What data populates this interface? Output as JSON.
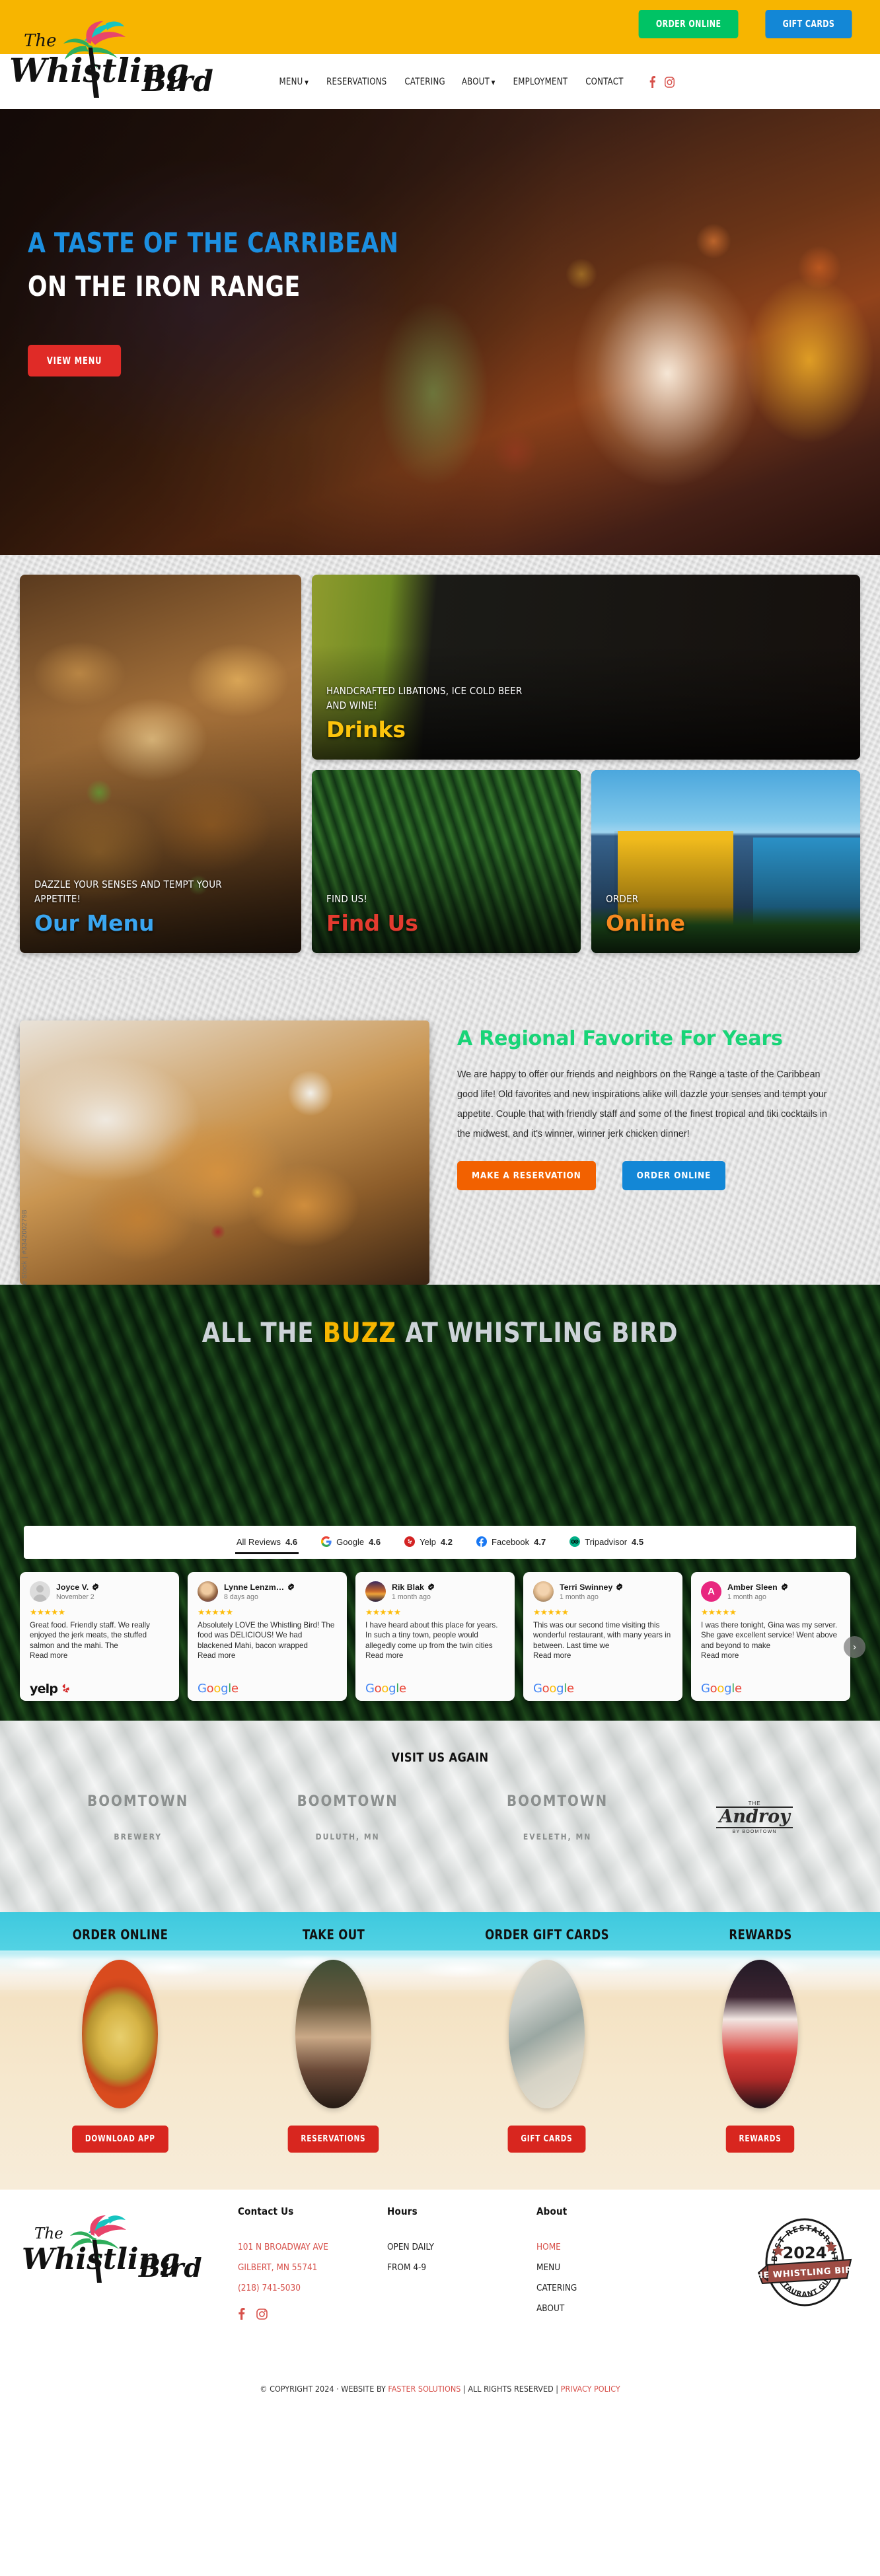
{
  "topbar": {
    "order_online": "ORDER ONLINE",
    "gift_cards": "GIFT CARDS",
    "order_color": "#00c365",
    "gift_color": "#1387d6",
    "bg_color": "#f7b500"
  },
  "brand": {
    "logo_the": "The",
    "logo_name": "Whistling Bird"
  },
  "nav": {
    "items": [
      {
        "label": "MENU",
        "caret": true
      },
      {
        "label": "RESERVATIONS",
        "caret": false
      },
      {
        "label": "CATERING",
        "caret": false
      },
      {
        "label": "ABOUT",
        "caret": true
      },
      {
        "label": "EMPLOYMENT",
        "caret": false
      },
      {
        "label": "CONTACT",
        "caret": false
      }
    ],
    "social": [
      "facebook-icon",
      "instagram-icon"
    ]
  },
  "hero": {
    "line1": "A TASTE OF THE CARRIBEAN",
    "line2": "ON THE IRON RANGE",
    "cta": "VIEW MENU",
    "line1_color": "#1c8fe0",
    "cta_color": "#e02b27"
  },
  "cards": {
    "menu": {
      "sub": "DAZZLE YOUR SENSES AND TEMPT YOUR APPETITE!",
      "title": "Our Menu",
      "color": "#3aa6f0"
    },
    "drinks": {
      "sub": "HANDCRAFTED LIBATIONS, ICE COLD BEER AND WINE!",
      "title": "Drinks",
      "color": "#fcc40c"
    },
    "find": {
      "sub": "FIND US!",
      "title": "Find Us",
      "color": "#e33b2f"
    },
    "online": {
      "sub": "ORDER",
      "title": "Online",
      "color": "#f7891f"
    }
  },
  "regional": {
    "title": "A Regional Favorite For Years",
    "title_color": "#18d477",
    "body": "We are happy to offer our friends and neighbors on the Range a taste of the Caribbean good life! Old favorites and new inspirations alike will dazzle your senses and tempt your appetite. Couple that with friendly staff and some of the finest tropical and tiki cocktails in the midwest, and it's winner, winner jerk chicken dinner!",
    "btn_reservation": "MAKE A RESERVATION",
    "btn_order": "ORDER ONLINE",
    "watermark": "e Stock | #334200279B"
  },
  "buzz": {
    "title_pre": "ALL THE ",
    "title_hl": "BUZZ",
    "title_post": " AT WHISTLING BIRD",
    "highlight_color": "#f7b500",
    "tabs": [
      {
        "name": "All Reviews",
        "score": "4.6",
        "icon": "none",
        "active": true
      },
      {
        "name": "Google",
        "score": "4.6",
        "icon": "google-icon",
        "active": false
      },
      {
        "name": "Yelp",
        "score": "4.2",
        "icon": "yelp-icon",
        "active": false
      },
      {
        "name": "Facebook",
        "score": "4.7",
        "icon": "facebook-icon",
        "active": false
      },
      {
        "name": "Tripadvisor",
        "score": "4.5",
        "icon": "tripadvisor-icon",
        "active": false
      }
    ],
    "reviews": [
      {
        "name": "Joyce V.",
        "date": "November 2",
        "stars": "★★★★★",
        "text": "Great food. Friendly staff. We really enjoyed the jerk meats, the stuffed salmon and the mahi. The",
        "read_more": "Read more",
        "source": "yelp",
        "avatar": "placeholder-avatar"
      },
      {
        "name": "Lynne Lenzm…",
        "date": "8 days ago",
        "stars": "★★★★★",
        "text": "Absolutely LOVE the Whistling Bird! The food was DELICIOUS! We had blackened Mahi, bacon wrapped",
        "read_more": "Read more",
        "source": "google",
        "avatar": "photo-avatar"
      },
      {
        "name": "Rik Blak",
        "date": "1 month ago",
        "stars": "★★★★★",
        "text": "I have heard about this place for years. In such a tiny town, people would allegedly come up from the twin cities",
        "read_more": "Read more",
        "source": "google",
        "avatar": "photo-avatar"
      },
      {
        "name": "Terri Swinney",
        "date": "1 month ago",
        "stars": "★★★★★",
        "text": "This was our second time visiting this wonderful restaurant, with many years in between. Last time we",
        "read_more": "Read more",
        "source": "google",
        "avatar": "photo-avatar"
      },
      {
        "name": "Amber Sleen",
        "date": "1 month ago",
        "stars": "★★★★★",
        "text": "I was there tonight, Gina was my server. She gave excellent service! Went above and beyond to make",
        "read_more": "Read more",
        "source": "google",
        "avatar": "A"
      }
    ],
    "next_label": "›"
  },
  "visit": {
    "title": "VISIT US AGAIN",
    "partners": [
      {
        "name": "BOOMTOWN",
        "sub": "BREWERY"
      },
      {
        "name": "BOOMTOWN",
        "sub": "DULUTH, MN"
      },
      {
        "name": "BOOMTOWN",
        "sub": "EVELETH, MN"
      }
    ],
    "androy": {
      "the": "THE",
      "name": "Androy",
      "by": "BY BOOMTOWN"
    }
  },
  "beach": {
    "items": [
      {
        "heading": "ORDER ONLINE",
        "button": "DOWNLOAD APP",
        "image": "pasta-photo"
      },
      {
        "heading": "TAKE OUT",
        "button": "RESERVATIONS",
        "image": "dining-room-photo"
      },
      {
        "heading": "ORDER GIFT CARDS",
        "button": "GIFT CARDS",
        "image": "seafood-photo"
      },
      {
        "heading": "REWARDS",
        "button": "REWARDS",
        "image": "cocktail-photo"
      }
    ],
    "button_color": "#d8261f"
  },
  "footer": {
    "contact": {
      "heading": "Contact Us",
      "address1": "101 N BROADWAY AVE",
      "address2": "GILBERT, MN 55741",
      "phone": "(218) 741-5030"
    },
    "hours": {
      "heading": "Hours",
      "line1": "OPEN DAILY",
      "line2": "FROM 4-9"
    },
    "about": {
      "heading": "About",
      "links": [
        "HOME",
        "MENU",
        "CATERING",
        "ABOUT"
      ]
    },
    "badge": {
      "top": "BEST RESTAURANT",
      "year": "2024",
      "ribbon": "THE WHISTLING BIRD",
      "bottom": "RESTAURANT GURU"
    },
    "copyright_pre": "© COPYRIGHT 2024 · WEBSITE BY ",
    "copyright_link": "FASTER SOLUTIONS",
    "copyright_mid": " | ALL RIGHTS RESERVED | ",
    "privacy": "PRIVACY POLICY"
  }
}
